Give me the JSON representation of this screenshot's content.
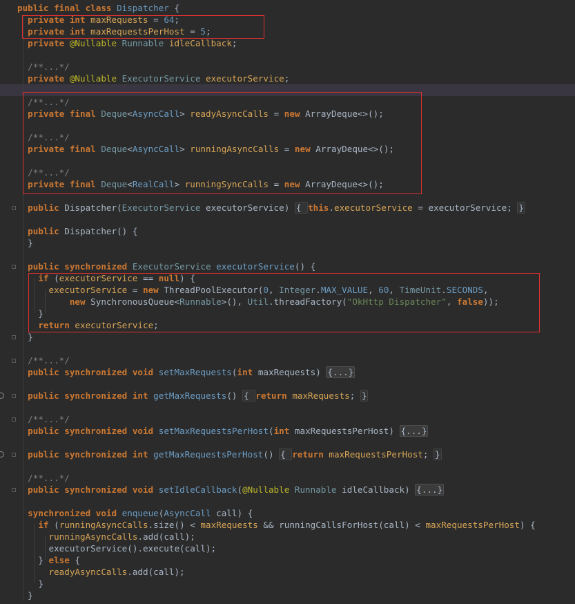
{
  "code_lines": [
    [
      {
        "t": "public final class ",
        "c": "k"
      },
      {
        "t": "Dispatcher",
        "c": "cls"
      },
      {
        "t": " {",
        "c": "t"
      }
    ],
    [
      {
        "t": "  "
      },
      {
        "t": "private int ",
        "c": "k"
      },
      {
        "t": "maxRequests",
        "c": "f"
      },
      {
        "t": " = ",
        "c": "t"
      },
      {
        "t": "64",
        "c": "n"
      },
      {
        "t": ";",
        "c": "t"
      }
    ],
    [
      {
        "t": "  "
      },
      {
        "t": "private int ",
        "c": "k"
      },
      {
        "t": "maxRequestsPerHost",
        "c": "f"
      },
      {
        "t": " = ",
        "c": "t"
      },
      {
        "t": "5",
        "c": "n"
      },
      {
        "t": ";",
        "c": "t"
      }
    ],
    [
      {
        "t": "  "
      },
      {
        "t": "private ",
        "c": "k"
      },
      {
        "t": "@Nullable ",
        "c": "a"
      },
      {
        "t": "Runnable ",
        "c": "ty"
      },
      {
        "t": "idleCallback",
        "c": "f"
      },
      {
        "t": ";",
        "c": "t"
      }
    ],
    [],
    [
      {
        "t": "  "
      },
      {
        "t": "/**...*/",
        "c": "c"
      }
    ],
    [
      {
        "t": "  "
      },
      {
        "t": "private ",
        "c": "k"
      },
      {
        "t": "@Nullable ",
        "c": "a"
      },
      {
        "t": "ExecutorService ",
        "c": "ty"
      },
      {
        "t": "executorService",
        "c": "f"
      },
      {
        "t": ";",
        "c": "t"
      }
    ],
    [],
    [
      {
        "t": "  "
      },
      {
        "t": "/**...*/",
        "c": "c"
      }
    ],
    [
      {
        "t": "  "
      },
      {
        "t": "private final ",
        "c": "k"
      },
      {
        "t": "Deque",
        "c": "ty"
      },
      {
        "t": "<",
        "c": "t"
      },
      {
        "t": "AsyncCall",
        "c": "m"
      },
      {
        "t": "> ",
        "c": "t"
      },
      {
        "t": "readyAsyncCalls",
        "c": "f"
      },
      {
        "t": " = ",
        "c": "t"
      },
      {
        "t": "new ",
        "c": "k"
      },
      {
        "t": "ArrayDeque<>();",
        "c": "t"
      }
    ],
    [],
    [
      {
        "t": "  "
      },
      {
        "t": "/**...*/",
        "c": "c"
      }
    ],
    [
      {
        "t": "  "
      },
      {
        "t": "private final ",
        "c": "k"
      },
      {
        "t": "Deque",
        "c": "ty"
      },
      {
        "t": "<",
        "c": "t"
      },
      {
        "t": "AsyncCall",
        "c": "m"
      },
      {
        "t": "> ",
        "c": "t"
      },
      {
        "t": "runningAsyncCalls",
        "c": "f"
      },
      {
        "t": " = ",
        "c": "t"
      },
      {
        "t": "new ",
        "c": "k"
      },
      {
        "t": "ArrayDeque<>();",
        "c": "t"
      }
    ],
    [],
    [
      {
        "t": "  "
      },
      {
        "t": "/**...*/",
        "c": "c"
      }
    ],
    [
      {
        "t": "  "
      },
      {
        "t": "private final ",
        "c": "k"
      },
      {
        "t": "Deque",
        "c": "ty"
      },
      {
        "t": "<",
        "c": "t"
      },
      {
        "t": "RealCall",
        "c": "m"
      },
      {
        "t": "> ",
        "c": "t"
      },
      {
        "t": "runningSyncCalls",
        "c": "f"
      },
      {
        "t": " = ",
        "c": "t"
      },
      {
        "t": "new ",
        "c": "k"
      },
      {
        "t": "ArrayDeque<>();",
        "c": "t"
      }
    ],
    [],
    [
      {
        "t": "  "
      },
      {
        "t": "public ",
        "c": "k"
      },
      {
        "t": "Dispatcher(",
        "c": "t"
      },
      {
        "t": "ExecutorService ",
        "c": "ty"
      },
      {
        "t": "executorService) ",
        "c": "t"
      },
      {
        "t": "{ ",
        "c": "fold-inline"
      },
      {
        "t": "this",
        "c": "k"
      },
      {
        "t": ".",
        "c": "t"
      },
      {
        "t": "executorService",
        "c": "f"
      },
      {
        "t": " = executorService; ",
        "c": "t"
      },
      {
        "t": "}",
        "c": "fold-inline"
      }
    ],
    [],
    [
      {
        "t": "  "
      },
      {
        "t": "public ",
        "c": "k"
      },
      {
        "t": "Dispatcher() {",
        "c": "t"
      }
    ],
    [
      {
        "t": "  }",
        "c": "t"
      }
    ],
    [],
    [
      {
        "t": "  "
      },
      {
        "t": "public synchronized ",
        "c": "k"
      },
      {
        "t": "ExecutorService ",
        "c": "ty"
      },
      {
        "t": "executorService",
        "c": "m"
      },
      {
        "t": "() {",
        "c": "t"
      }
    ],
    [
      {
        "t": "    "
      },
      {
        "t": "if ",
        "c": "k"
      },
      {
        "t": "(",
        "c": "t"
      },
      {
        "t": "executorService",
        "c": "f"
      },
      {
        "t": " == ",
        "c": "t"
      },
      {
        "t": "null",
        "c": "k"
      },
      {
        "t": ") {",
        "c": "t"
      }
    ],
    [
      {
        "t": "      "
      },
      {
        "t": "executorService",
        "c": "f"
      },
      {
        "t": " = ",
        "c": "t"
      },
      {
        "t": "new ",
        "c": "k"
      },
      {
        "t": "ThreadPoolExecutor(",
        "c": "t"
      },
      {
        "t": "0",
        "c": "n"
      },
      {
        "t": ", ",
        "c": "t"
      },
      {
        "t": "Integer",
        "c": "ty"
      },
      {
        "t": ".",
        "c": "t"
      },
      {
        "t": "MAX_VALUE",
        "c": "m"
      },
      {
        "t": ", ",
        "c": "t"
      },
      {
        "t": "60",
        "c": "n"
      },
      {
        "t": ", ",
        "c": "t"
      },
      {
        "t": "TimeUnit",
        "c": "ty"
      },
      {
        "t": ".",
        "c": "t"
      },
      {
        "t": "SECONDS",
        "c": "m"
      },
      {
        "t": ",",
        "c": "t"
      }
    ],
    [
      {
        "t": "          "
      },
      {
        "t": "new ",
        "c": "k"
      },
      {
        "t": "SynchronousQueue<",
        "c": "t"
      },
      {
        "t": "Runnable",
        "c": "ty"
      },
      {
        "t": ">(), ",
        "c": "t"
      },
      {
        "t": "Util",
        "c": "ty"
      },
      {
        "t": ".",
        "c": "t"
      },
      {
        "t": "threadFactory(",
        "c": "t"
      },
      {
        "t": "\"OkHttp Dispatcher\"",
        "c": "s"
      },
      {
        "t": ", ",
        "c": "t"
      },
      {
        "t": "false",
        "c": "k"
      },
      {
        "t": "));",
        "c": "t"
      }
    ],
    [
      {
        "t": "    }",
        "c": "t"
      }
    ],
    [
      {
        "t": "    "
      },
      {
        "t": "return ",
        "c": "k"
      },
      {
        "t": "executorService",
        "c": "f"
      },
      {
        "t": ";",
        "c": "t"
      }
    ],
    [
      {
        "t": "  }",
        "c": "t"
      }
    ],
    [],
    [
      {
        "t": "  "
      },
      {
        "t": "/**...*/",
        "c": "c"
      }
    ],
    [
      {
        "t": "  "
      },
      {
        "t": "public synchronized void ",
        "c": "k"
      },
      {
        "t": "setMaxRequests",
        "c": "m"
      },
      {
        "t": "(",
        "c": "t"
      },
      {
        "t": "int ",
        "c": "k"
      },
      {
        "t": "maxRequests) ",
        "c": "t"
      },
      {
        "t": "{...}",
        "c": "fold"
      }
    ],
    [],
    [
      {
        "t": "  "
      },
      {
        "t": "public synchronized int ",
        "c": "k"
      },
      {
        "t": "getMaxRequests",
        "c": "m"
      },
      {
        "t": "() ",
        "c": "t"
      },
      {
        "t": "{ ",
        "c": "fold-inline"
      },
      {
        "t": "return ",
        "c": "k"
      },
      {
        "t": "maxRequests",
        "c": "f"
      },
      {
        "t": "; ",
        "c": "t"
      },
      {
        "t": "}",
        "c": "fold-inline"
      }
    ],
    [],
    [
      {
        "t": "  "
      },
      {
        "t": "/**...*/",
        "c": "c"
      }
    ],
    [
      {
        "t": "  "
      },
      {
        "t": "public synchronized void ",
        "c": "k"
      },
      {
        "t": "setMaxRequestsPerHost",
        "c": "m"
      },
      {
        "t": "(",
        "c": "t"
      },
      {
        "t": "int ",
        "c": "k"
      },
      {
        "t": "maxRequestsPerHost) ",
        "c": "t"
      },
      {
        "t": "{...}",
        "c": "fold"
      }
    ],
    [],
    [
      {
        "t": "  "
      },
      {
        "t": "public synchronized int ",
        "c": "k"
      },
      {
        "t": "getMaxRequestsPerHost",
        "c": "m"
      },
      {
        "t": "() ",
        "c": "t"
      },
      {
        "t": "{ ",
        "c": "fold-inline"
      },
      {
        "t": "return ",
        "c": "k"
      },
      {
        "t": "maxRequestsPerHost",
        "c": "f"
      },
      {
        "t": "; ",
        "c": "t"
      },
      {
        "t": "}",
        "c": "fold-inline"
      }
    ],
    [],
    [
      {
        "t": "  "
      },
      {
        "t": "/**...*/",
        "c": "c"
      }
    ],
    [
      {
        "t": "  "
      },
      {
        "t": "public synchronized void ",
        "c": "k"
      },
      {
        "t": "setIdleCallback",
        "c": "m"
      },
      {
        "t": "(",
        "c": "t"
      },
      {
        "t": "@Nullable ",
        "c": "a"
      },
      {
        "t": "Runnable ",
        "c": "ty"
      },
      {
        "t": "idleCallback) ",
        "c": "t"
      },
      {
        "t": "{...}",
        "c": "fold"
      }
    ],
    [],
    [
      {
        "t": "  "
      },
      {
        "t": "synchronized void ",
        "c": "k"
      },
      {
        "t": "enqueue",
        "c": "m"
      },
      {
        "t": "(",
        "c": "t"
      },
      {
        "t": "AsyncCall ",
        "c": "m"
      },
      {
        "t": "call) {",
        "c": "t"
      }
    ],
    [
      {
        "t": "    "
      },
      {
        "t": "if ",
        "c": "k"
      },
      {
        "t": "(",
        "c": "t"
      },
      {
        "t": "runningAsyncCalls",
        "c": "f"
      },
      {
        "t": ".size() < ",
        "c": "t"
      },
      {
        "t": "maxRequests",
        "c": "f"
      },
      {
        "t": " && runningCallsForHost(call) < ",
        "c": "t"
      },
      {
        "t": "maxRequestsPerHost",
        "c": "f"
      },
      {
        "t": ") {",
        "c": "t"
      }
    ],
    [
      {
        "t": "      "
      },
      {
        "t": "runningAsyncCalls",
        "c": "f"
      },
      {
        "t": ".add(call);",
        "c": "t"
      }
    ],
    [
      {
        "t": "      "
      },
      {
        "t": "executorService().execute(call);",
        "c": "t"
      }
    ],
    [
      {
        "t": "    "
      },
      {
        "t": "} ",
        "c": "t"
      },
      {
        "t": "else ",
        "c": "k"
      },
      {
        "t": "{",
        "c": "t"
      }
    ],
    [
      {
        "t": "      "
      },
      {
        "t": "readyAsyncCalls",
        "c": "f"
      },
      {
        "t": ".add(call);",
        "c": "t"
      }
    ],
    [
      {
        "t": "    }",
        "c": "t"
      }
    ],
    [
      {
        "t": "  }",
        "c": "t"
      }
    ]
  ]
}
